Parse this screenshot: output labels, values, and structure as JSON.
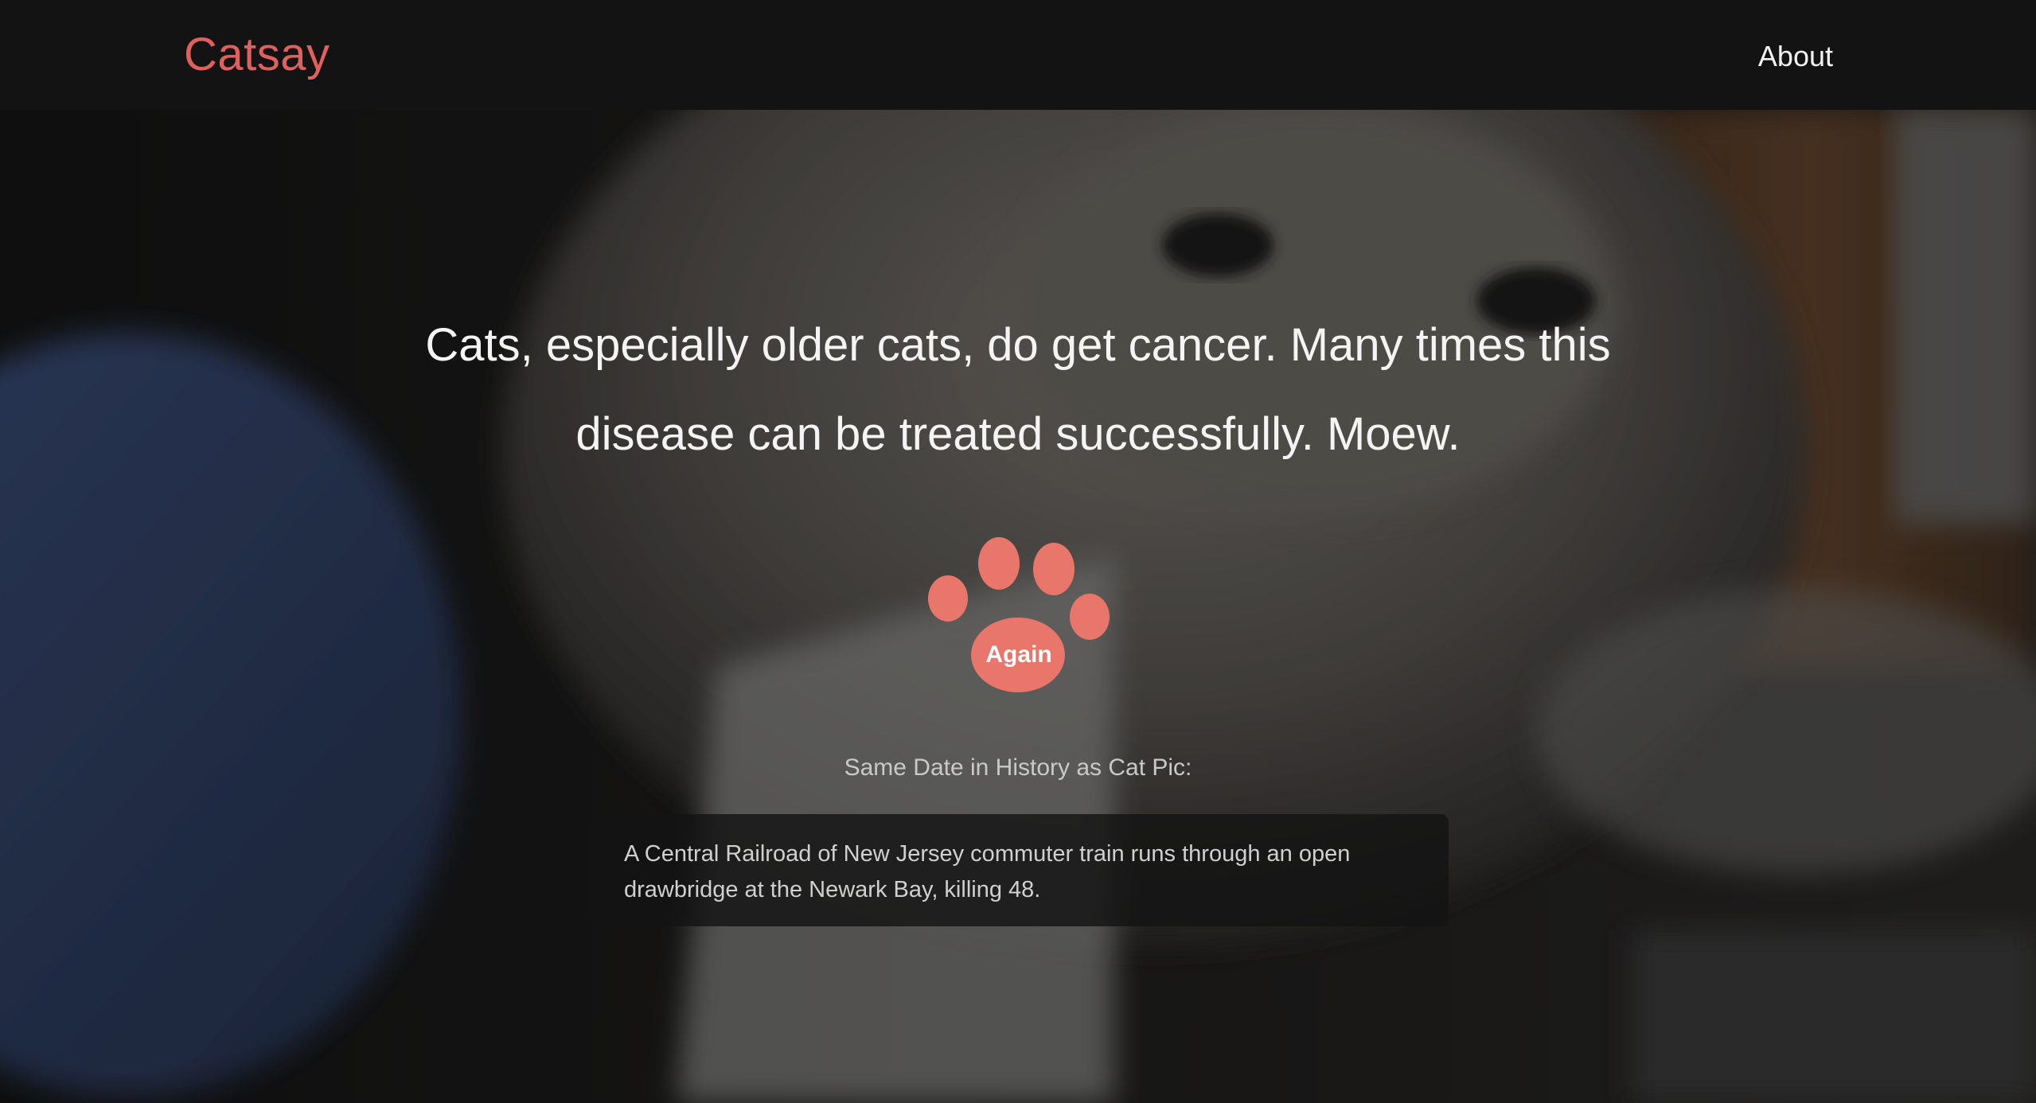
{
  "app": {
    "brand": "Catsay",
    "nav": {
      "about_label": "About"
    },
    "brand_color": "#e0605e"
  },
  "main": {
    "fact": "Cats, especially older cats, do get cancer. Many times this disease can be treated successfully. Moew.",
    "again_button_label": "Again",
    "again_button_icon": "paw-icon",
    "accent_color": "#e8766a",
    "history_label": "Same Date in History as Cat Pic:",
    "history_text": "A Central Railroad of New Jersey commuter train runs through an open drawbridge at the Newark Bay, killing 48."
  }
}
